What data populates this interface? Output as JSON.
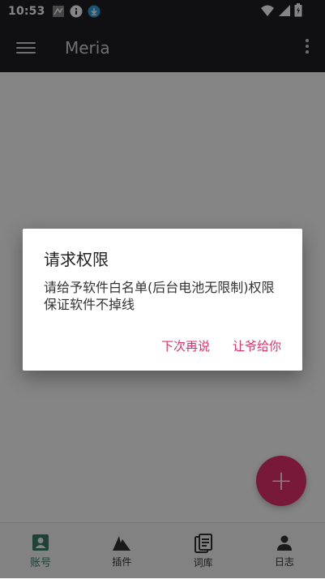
{
  "status_bar": {
    "time": "10:53"
  },
  "app_bar": {
    "title": "Meria"
  },
  "fab": {
    "symbol": "+"
  },
  "bottom_nav": {
    "items": [
      {
        "label": "账号",
        "icon": "account-icon",
        "active": true
      },
      {
        "label": "插件",
        "icon": "plugin-icon",
        "active": false
      },
      {
        "label": "词库",
        "icon": "dictionary-icon",
        "active": false
      },
      {
        "label": "日志",
        "icon": "log-icon",
        "active": false
      }
    ]
  },
  "dialog": {
    "title": "请求权限",
    "body": "请给予软件白名单(后台电池无限制)权限保证软件不掉线",
    "negative": "下次再说",
    "positive": "让爷给你"
  },
  "colors": {
    "accent": "#e8306e",
    "active_tab": "#3a7d6c",
    "app_bar": "#1f2023"
  }
}
